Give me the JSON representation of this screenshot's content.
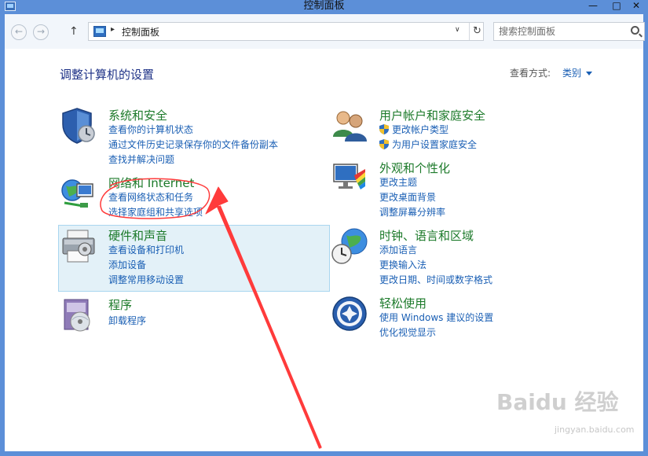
{
  "window": {
    "title": "控制面板",
    "min": "—",
    "max": "□",
    "close": "✕"
  },
  "nav": {
    "back": "←",
    "forward": "→",
    "up": "↑"
  },
  "address": {
    "path": "控制面板",
    "separator": "▸",
    "dropdown": "∨",
    "refresh": "↻"
  },
  "search": {
    "placeholder": "搜索控制面板"
  },
  "header": {
    "title": "调整计算机的设置",
    "view_label": "查看方式:",
    "view_value": "类别"
  },
  "categories": [
    {
      "title": "系统和安全",
      "links": [
        "查看你的计算机状态",
        "通过文件历史记录保存你的文件备份副本",
        "查找并解决问题"
      ],
      "icon": "shield-icon"
    },
    {
      "title": "网络和 Internet",
      "links": [
        "查看网络状态和任务",
        "选择家庭组和共享选项"
      ],
      "icon": "network-icon"
    },
    {
      "title": "硬件和声音",
      "links": [
        "查看设备和打印机",
        "添加设备",
        "调整常用移动设置"
      ],
      "icon": "printer-icon"
    },
    {
      "title": "程序",
      "links": [
        "卸载程序"
      ],
      "icon": "programs-icon"
    },
    {
      "title": "用户帐户和家庭安全",
      "links": [
        "更改帐户类型",
        "为用户设置家庭安全"
      ],
      "icon": "users-icon"
    },
    {
      "title": "外观和个性化",
      "links": [
        "更改主题",
        "更改桌面背景",
        "调整屏幕分辨率"
      ],
      "icon": "appearance-icon"
    },
    {
      "title": "时钟、语言和区域",
      "links": [
        "添加语言",
        "更换输入法",
        "更改日期、时间或数字格式"
      ],
      "icon": "clock-globe-icon"
    },
    {
      "title": "轻松使用",
      "links": [
        "使用 Windows 建议的设置",
        "优化视觉显示"
      ],
      "icon": "ease-of-access-icon"
    }
  ],
  "watermark": {
    "main": "Baidu 经验",
    "sub": "jingyan.baidu.com"
  },
  "colors": {
    "title_bar": "#5c8fd8",
    "category_title": "#1c7a2a",
    "link": "#1a5fb4",
    "highlight": "#e3f1f8",
    "annotation": "#ff3b3b"
  }
}
